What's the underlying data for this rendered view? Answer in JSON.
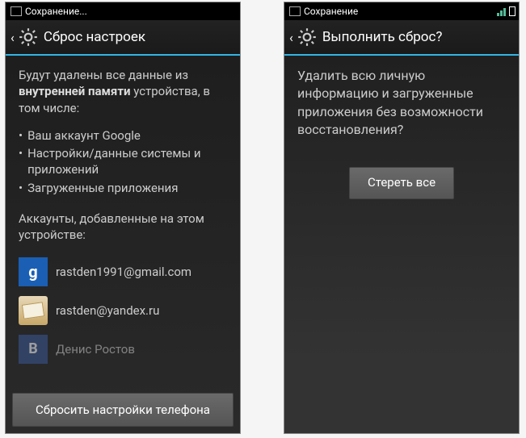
{
  "left": {
    "statusbar": {
      "text": "Сохранение..."
    },
    "title": "Сброс настроек",
    "intro_pre": "Будут удалены все данные из ",
    "intro_bold": "внутренней памяти",
    "intro_post": " устройства, в том числе:",
    "bullets": [
      "Ваш аккаунт Google",
      "Настройки/данные системы и приложений",
      "Загруженные приложения"
    ],
    "accounts_label": "Аккаунты, добавленные на этом устройстве:",
    "accounts": [
      {
        "icon": "google",
        "glyph": "g",
        "email": "rastden1991@gmail.com"
      },
      {
        "icon": "mail",
        "glyph": "",
        "email": "rastden@yandex.ru"
      },
      {
        "icon": "vk",
        "glyph": "B",
        "email": "Денис Ростов"
      }
    ],
    "footer_button": "Сбросить настройки телефона"
  },
  "right": {
    "statusbar": {
      "text": "Сохранение"
    },
    "title": "Выполнить сброс?",
    "confirm_text": "Удалить всю личную информацию и загруженные приложения без возможности восстановления?",
    "erase_button": "Стереть все"
  }
}
